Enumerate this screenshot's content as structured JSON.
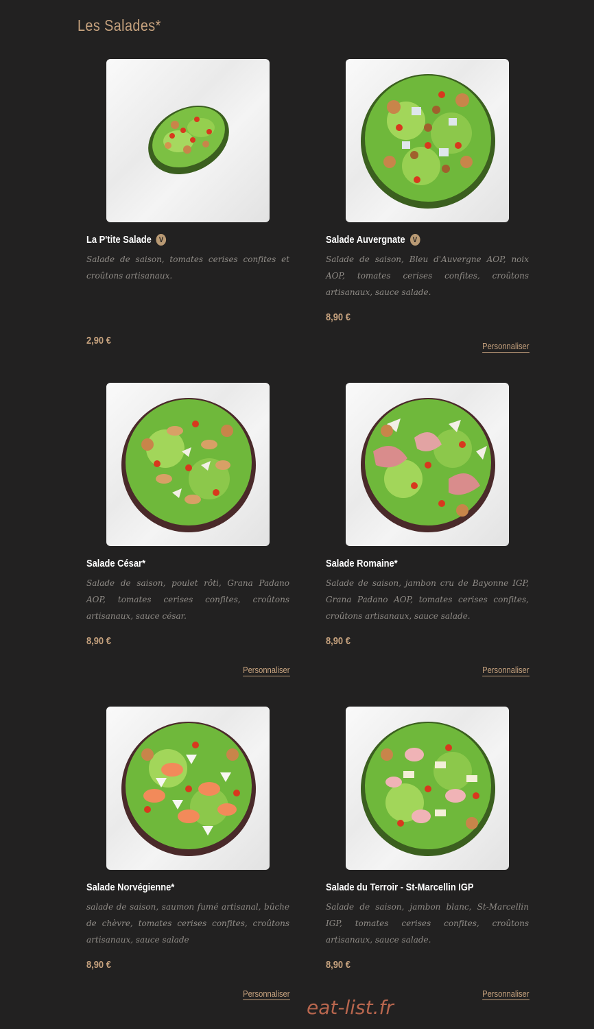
{
  "section": {
    "title": "Les Salades*"
  },
  "items": [
    {
      "name": "La P'tite Salade",
      "badge": "V",
      "description": "Salade de saison, tomates cerises confites et croûtons artisanaux.",
      "price": "2,90 €",
      "customize_label": ""
    },
    {
      "name": "Salade Auvergnate",
      "badge": "V",
      "description": "Salade de saison, Bleu d'Auvergne AOP, noix AOP, tomates cerises confites, croûtons artisanaux, sauce salade.",
      "price": "8,90 €",
      "customize_label": "Personnaliser"
    },
    {
      "name": "Salade César*",
      "badge": "",
      "description": "Salade de saison, poulet rôti, Grana Padano AOP, tomates cerises confites, croûtons artisanaux, sauce césar.",
      "price": "8,90 €",
      "customize_label": "Personnaliser"
    },
    {
      "name": "Salade Romaine*",
      "badge": "",
      "description": "Salade de saison, jambon cru de Bayonne IGP, Grana Padano AOP, tomates cerises confites, croûtons artisanaux, sauce salade.",
      "price": "8,90 €",
      "customize_label": "Personnaliser"
    },
    {
      "name": "Salade Norvégienne*",
      "badge": "",
      "description": "salade de saison, saumon fumé artisanal, bûche de chèvre, tomates cerises confites, croûtons artisanaux, sauce salade",
      "price": "8,90 €",
      "customize_label": "Personnaliser"
    },
    {
      "name": "Salade du Terroir - St-Marcellin IGP",
      "badge": "",
      "description": "Salade de saison, jambon blanc, St-Marcellin IGP, tomates cerises confites, croûtons artisanaux, sauce salade.",
      "price": "8,90 €",
      "customize_label": "Personnaliser"
    }
  ],
  "watermark": "eat-list.fr",
  "colors": {
    "background": "#222121",
    "accent": "#c6a27e",
    "description": "#8f8b86"
  }
}
